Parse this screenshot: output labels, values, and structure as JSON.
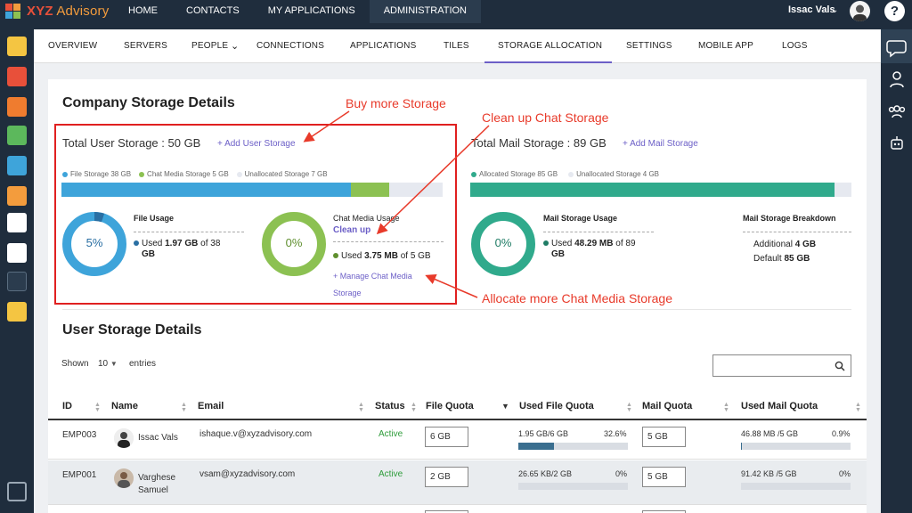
{
  "brand": {
    "name_main": "XYZ",
    "name_rest": " Advisory"
  },
  "topnav": [
    "HOME",
    "CONTACTS",
    "MY APPLICATIONS",
    "ADMINISTRATION"
  ],
  "user": {
    "name": "Issac Vals",
    "caret": "⌄"
  },
  "help": "?",
  "subnav": [
    "OVERVIEW",
    "SERVERS",
    "PEOPLE",
    "CONNECTIONS",
    "APPLICATIONS",
    "TILES",
    "STORAGE ALLOCATION",
    "SETTINGS",
    "MOBILE APP",
    "LOGS"
  ],
  "subnav_people_caret": "⌄",
  "company": {
    "title": "Company Storage Details",
    "user_storage": {
      "total": "Total User Storage : 50 GB",
      "add": "+ Add User Storage",
      "legend": [
        "File Storage 38 GB",
        "Chat Media Storage 5 GB",
        "Unallocated Storage 7 GB"
      ],
      "fill_fraction": {
        "file": 0.76,
        "chat": 0.1
      },
      "file_usage": {
        "title": "File Usage",
        "percent": "5%",
        "used_prefix": "Used ",
        "used_value": "1.97 GB",
        "used_suffix": " of 38",
        "used_line2": "GB",
        "fraction": 0.05
      },
      "chat_usage": {
        "title": "Chat Media Usage",
        "cleanup": "Clean up",
        "percent": "0%",
        "used_prefix": "Used ",
        "used_value": "3.75 MB",
        "used_suffix": " of 5 GB",
        "manage1": "+ Manage Chat Media",
        "manage2": "Storage",
        "fraction": 0.0
      }
    },
    "mail_storage": {
      "total": "Total Mail Storage : 89 GB",
      "add": "+ Add Mail Storage",
      "legend": [
        "Allocated Storage 85 GB",
        "Unallocated Storage 4 GB"
      ],
      "fill_fraction": 0.955,
      "usage": {
        "title": "Mail Storage Usage",
        "percent": "0%",
        "used_prefix": "Used ",
        "used_value": "48.29 MB",
        "used_suffix": " of 89",
        "used_line2": "GB"
      },
      "breakdown": {
        "title": "Mail Storage Breakdown",
        "additional_label": "Additional ",
        "additional_value": "4 GB",
        "default_label": "Default ",
        "default_value": "85 GB"
      }
    }
  },
  "annotations": {
    "buy": "Buy more Storage",
    "cleanup": "Clean up Chat Storage",
    "allocate": "Allocate more Chat Media Storage"
  },
  "users": {
    "title": "User Storage Details",
    "shown": "Shown",
    "entries_value": "10",
    "entries": "entries",
    "columns": [
      "ID",
      "Name",
      "Email",
      "Status",
      "File Quota",
      "Used File Quota",
      "Mail Quota",
      "Used Mail Quota"
    ],
    "rows": [
      {
        "id": "EMP003",
        "name1": "Issac Vals",
        "name2": "",
        "email": "ishaque.v@xyzadvisory.com",
        "status": "Active",
        "file_quota": "6 GB",
        "used_file": "1.95 GB/6 GB",
        "used_file_pct": "32.6%",
        "used_file_frac": 0.326,
        "mail_quota": "5 GB",
        "used_mail": "46.88 MB /5 GB",
        "used_mail_pct": "0.9%",
        "used_mail_frac": 0.009
      },
      {
        "id": "EMP001",
        "name1": "Varghese",
        "name2": "Samuel",
        "email": "vsam@xyzadvisory.com",
        "status": "Active",
        "file_quota": "2 GB",
        "used_file": "26.65 KB/2 GB",
        "used_file_pct": "0%",
        "used_file_frac": 0,
        "mail_quota": "5 GB",
        "used_mail": "91.42 KB /5 GB",
        "used_mail_pct": "0%",
        "used_mail_frac": 0
      }
    ]
  },
  "colors": {
    "file": "#3ea4da",
    "chat": "#8cc152",
    "unalloc": "#e6e9f0",
    "mail": "#30aa8c",
    "accent": "#6c5fc7",
    "annot": "#e83a2a"
  }
}
